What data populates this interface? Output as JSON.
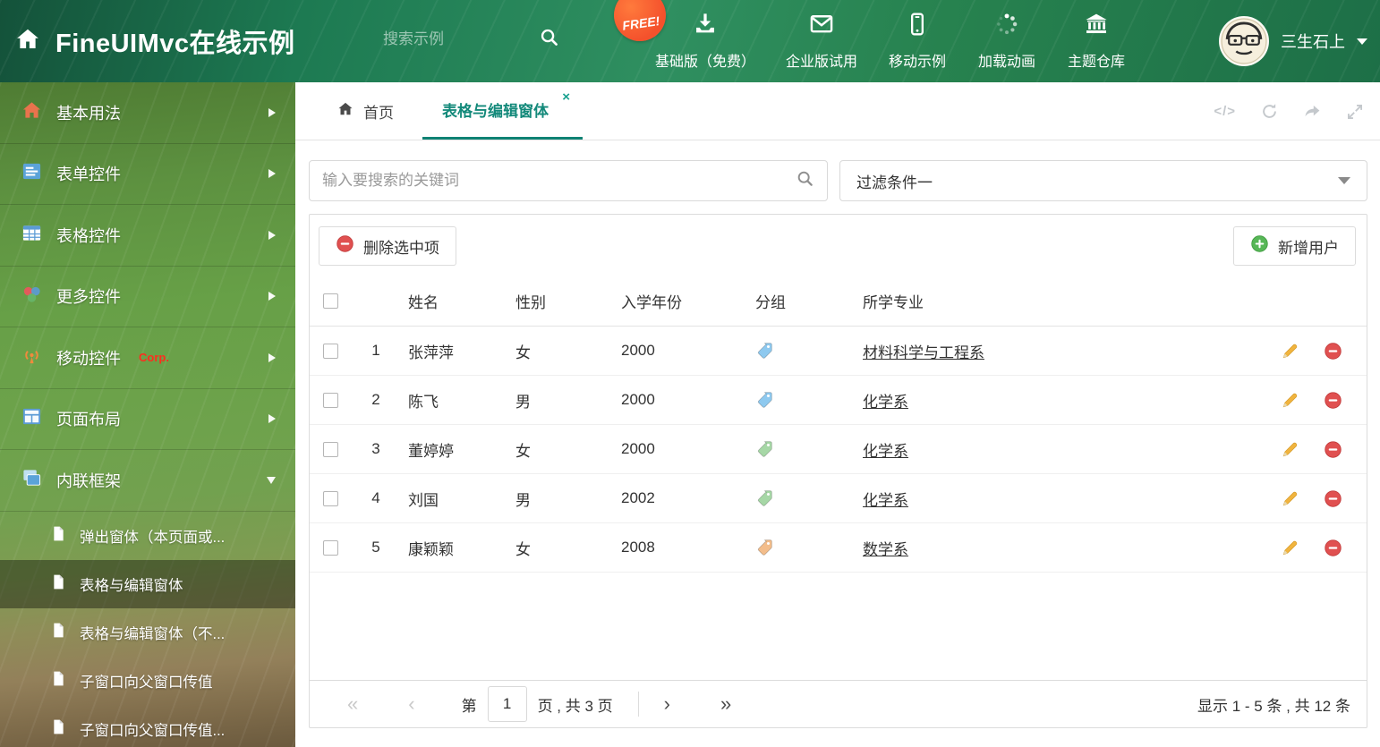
{
  "header": {
    "title": "FineUIMvc在线示例",
    "search_placeholder": "搜索示例",
    "free_badge": "FREE!",
    "nav": [
      {
        "label": "基础版（免费）"
      },
      {
        "label": "企业版试用"
      },
      {
        "label": "移动示例"
      },
      {
        "label": "加载动画"
      },
      {
        "label": "主题仓库"
      }
    ],
    "user_name": "三生石上"
  },
  "sidebar": {
    "items": [
      {
        "label": "基本用法"
      },
      {
        "label": "表单控件"
      },
      {
        "label": "表格控件"
      },
      {
        "label": "更多控件"
      },
      {
        "label": "移动控件",
        "badge": "Corp."
      },
      {
        "label": "页面布局"
      },
      {
        "label": "内联框架"
      }
    ],
    "subitems": [
      {
        "label": "弹出窗体（本页面或..."
      },
      {
        "label": "表格与编辑窗体"
      },
      {
        "label": "表格与编辑窗体（不..."
      },
      {
        "label": "子窗口向父窗口传值"
      },
      {
        "label": "子窗口向父窗口传值..."
      }
    ]
  },
  "tabs": {
    "home": "首页",
    "active": "表格与编辑窗体",
    "close_glyph": "×",
    "code_icon_text": "</>"
  },
  "filter_bar": {
    "search_placeholder": "输入要搜索的关键词",
    "filter_selected": "过滤条件一"
  },
  "toolbar": {
    "delete_selected": "删除选中项",
    "add_user": "新增用户"
  },
  "table": {
    "headers": {
      "name": "姓名",
      "gender": "性别",
      "year": "入学年份",
      "group": "分组",
      "major": "所学专业"
    },
    "rows": [
      {
        "num": "1",
        "name": "张萍萍",
        "gender": "女",
        "year": "2000",
        "tag_color": "#8ec9ef",
        "major": "材料科学与工程系"
      },
      {
        "num": "2",
        "name": "陈飞",
        "gender": "男",
        "year": "2000",
        "tag_color": "#8ec9ef",
        "major": "化学系"
      },
      {
        "num": "3",
        "name": "董婷婷",
        "gender": "女",
        "year": "2000",
        "tag_color": "#a6d7a6",
        "major": "化学系"
      },
      {
        "num": "4",
        "name": "刘国",
        "gender": "男",
        "year": "2002",
        "tag_color": "#a6d7a6",
        "major": "化学系"
      },
      {
        "num": "5",
        "name": "康颖颖",
        "gender": "女",
        "year": "2008",
        "tag_color": "#f3bd8b",
        "major": "数学系"
      }
    ]
  },
  "pagination": {
    "first": "«",
    "prev": "‹",
    "page_prefix": "第",
    "page_value": "1",
    "page_suffix": "页 , 共 3 页",
    "next": "›",
    "last": "»",
    "summary": "显示 1 - 5 条 , 共 12 条"
  },
  "colors": {
    "accent": "#0f8274",
    "header_green": "#1d7a52",
    "badge_red": "#f4512c",
    "tag_blue": "#8ec9ef",
    "tag_green": "#a6d7a6",
    "tag_orange": "#f3bd8b"
  }
}
